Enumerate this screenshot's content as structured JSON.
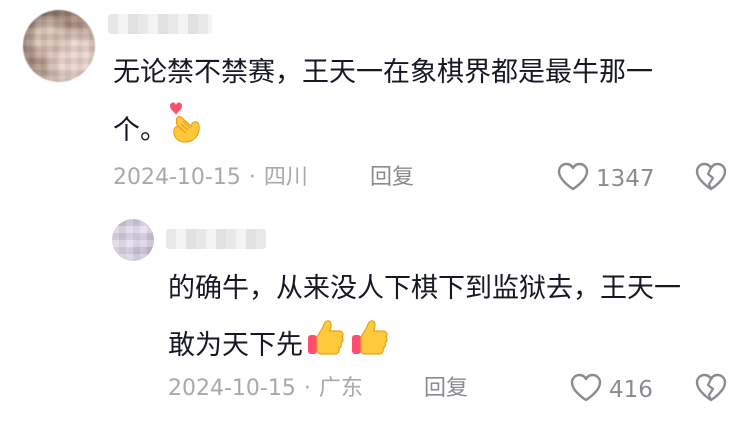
{
  "comments": [
    {
      "text_line_1": "无论禁不禁赛，王天一在象棋界都是最牛那一",
      "text_line_2": "个。",
      "emoji": "heart-hands-emoji",
      "date": "2024-10-15",
      "separator": "·",
      "location": "四川",
      "reply_label": "回复",
      "like_count": "1347"
    },
    {
      "text_line_1": "的确牛，从来没人下棋下到监狱去，王天一",
      "text_line_2": "敢为天下先",
      "emoji": "thumbs-up-emoji",
      "date": "2024-10-15",
      "separator": "·",
      "location": "广东",
      "reply_label": "回复",
      "like_count": "416"
    }
  ],
  "colors": {
    "text": "#161823",
    "meta": "#a8a9ae",
    "action": "#8a8b91",
    "emoji_yellow": "#ffc83d",
    "emoji_pink": "#ff4d6d"
  }
}
